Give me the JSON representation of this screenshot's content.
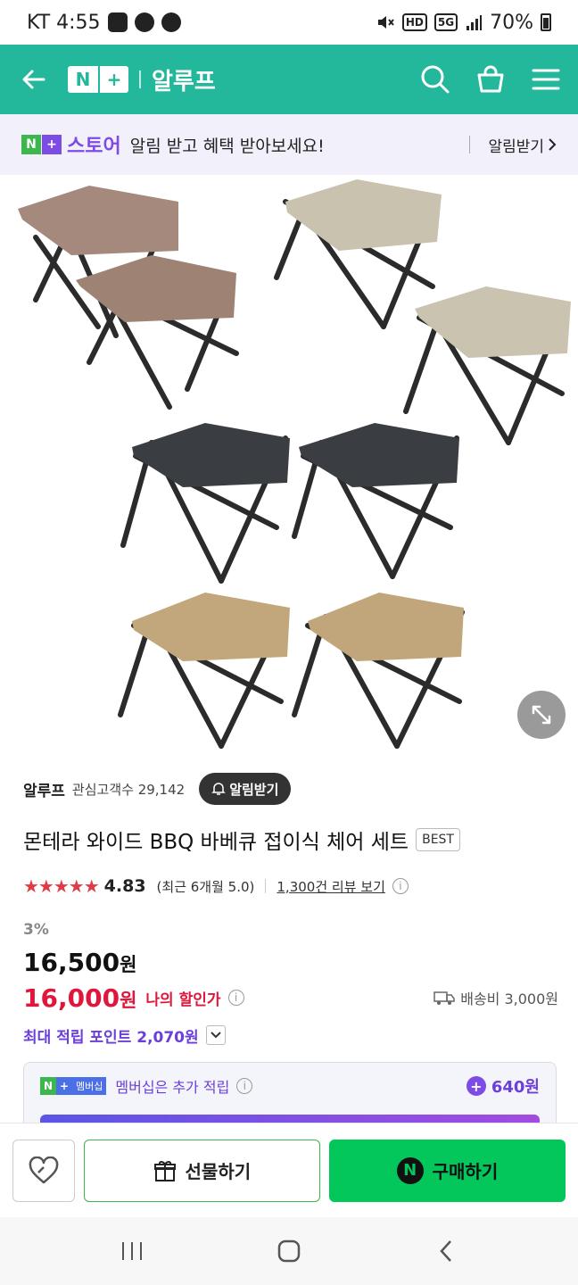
{
  "status_bar": {
    "carrier_time": "KT 4:55",
    "hd_label": "HD",
    "net_label": "5G",
    "battery": "70%"
  },
  "header": {
    "logo_n": "N",
    "logo_plus": "+",
    "store_name": "알루프"
  },
  "banner": {
    "logo_n": "N",
    "logo_plus": "+",
    "store_label": "스토어",
    "message": "알림 받고 혜택 받아보세요!",
    "link_label": "알림받기"
  },
  "seller": {
    "name": "알루프",
    "followers": "관심고객수 29,142",
    "alarm_label": "알림받기"
  },
  "product": {
    "title": "몬테라 와이드 BBQ 바베큐 접이식 체어 세트",
    "badge": "BEST",
    "stars": "★★★★★",
    "rating": "4.83",
    "recent": "(최근 6개월 5.0)",
    "review_link": "1,300건 리뷰 보기",
    "info_glyph": "i"
  },
  "price": {
    "discount": "3%",
    "original": "16,500",
    "sale": "16,000",
    "currency": "원",
    "my_price_label": "나의 할인가",
    "info_glyph": "i",
    "shipping": "배송비 3,000원"
  },
  "points": {
    "label": "최대 적립 포인트 2,070원"
  },
  "membership": {
    "badge_n": "N",
    "badge_plus": "+",
    "badge_label": "멤버십",
    "text": "멤버십은 추가 적립",
    "info_glyph": "i",
    "plus_glyph": "+",
    "points": "640원"
  },
  "bottom": {
    "gift_label": "선물하기",
    "buy_label": "구매하기",
    "npay_glyph": "N"
  },
  "colors": {
    "header": "#23b79b",
    "naver_green": "#03c75a",
    "accent_purple": "#6b3fd8",
    "sale_red": "#e0173c",
    "star_red": "#e03a45"
  }
}
